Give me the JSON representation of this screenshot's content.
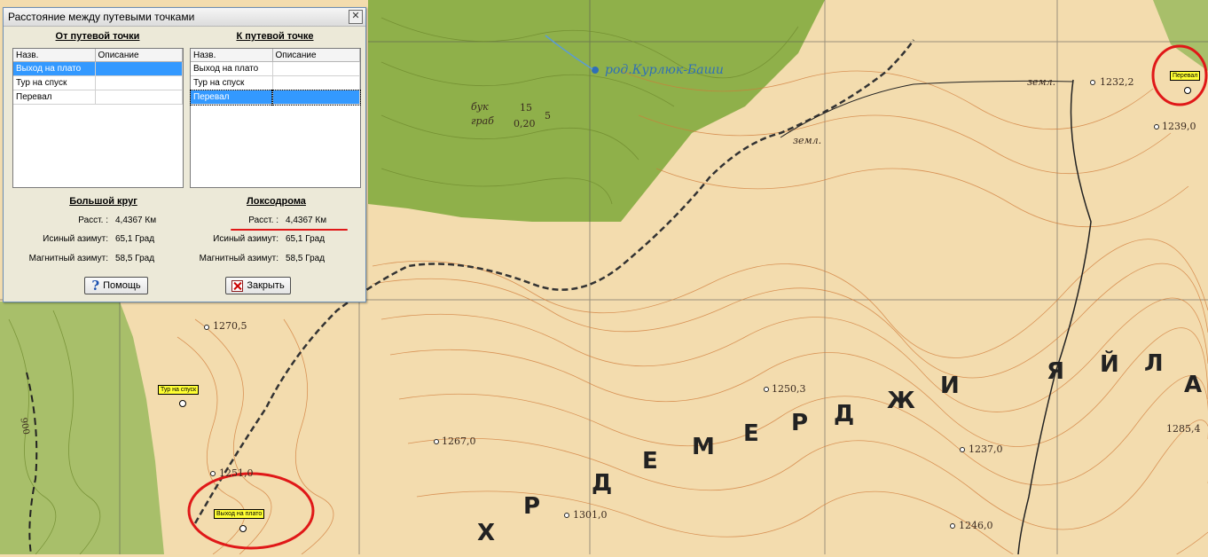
{
  "dialog": {
    "title": "Расстояние между путевыми точками",
    "from_header": "От путевой точки",
    "to_header": "К путевой точке",
    "columns": [
      "Назв.",
      "Описание"
    ],
    "from_list": [
      "Выход на плато",
      "Тур на спуск",
      "Перевал"
    ],
    "to_list": [
      "Выход на плато",
      "Тур на спуск",
      "Перевал"
    ],
    "great_circle_header": "Большой круг",
    "loxodrome_header": "Локсодрома",
    "labels": {
      "distance": "Расст. :",
      "true_azimuth": "Исиный азимут:",
      "magnetic_azimuth": "Магнитный азимут:"
    },
    "great_circle": {
      "distance": "4,4367 Км",
      "true_azimuth": "65,1 Град",
      "magnetic_azimuth": "58,5 Град"
    },
    "loxodrome": {
      "distance": "4,4367 Км",
      "true_azimuth": "65,1 Град",
      "magnetic_azimuth": "58,5 Град"
    },
    "help_button": "Помощь",
    "close_button": "Закрыть",
    "close_glyph": "✕"
  },
  "map": {
    "spring_label": "род.Курлюк-Баши",
    "forest_note_top": "бук",
    "forest_note_bottom": "граб",
    "forest_value_top": "15",
    "forest_value_bottom": "0,20",
    "forest_side": "5",
    "elevations": [
      "1232,2",
      "1239,0",
      "1270,5",
      "1250,3",
      "1267,0",
      "1237,0",
      "1285,4",
      "1251,0",
      "1301,0",
      "1246,0"
    ],
    "road_labels": [
      "земл.",
      "земл."
    ],
    "contour_label": "900",
    "ridge_letters": [
      "Х",
      "Р",
      "Д",
      "Е",
      "М",
      "Е",
      "Р",
      "Д",
      "Ж",
      "И",
      "Я",
      "Й",
      "Л",
      "А"
    ],
    "waypoints": [
      {
        "name": "Выход на плато"
      },
      {
        "name": "Тур на спуск"
      },
      {
        "name": "Перевал"
      }
    ]
  },
  "colors": {
    "highlight": "#e01818",
    "selection": "#3399ff",
    "forest": "#8fb04a",
    "terrain": "#f3dcae",
    "contour": "#d07a38"
  }
}
